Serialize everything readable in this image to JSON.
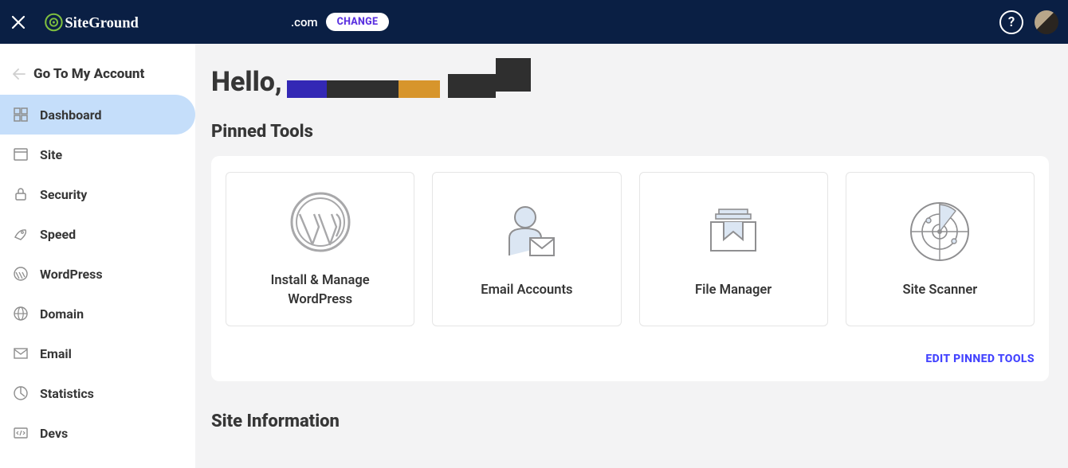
{
  "header": {
    "brand": "SiteGround",
    "domain_suffix": ".com",
    "change_label": "CHANGE",
    "help_glyph": "?"
  },
  "sidebar": {
    "back_label": "Go To My Account",
    "items": [
      {
        "label": "Dashboard",
        "icon": "dashboard-icon",
        "active": true
      },
      {
        "label": "Site",
        "icon": "site-icon",
        "active": false
      },
      {
        "label": "Security",
        "icon": "security-icon",
        "active": false
      },
      {
        "label": "Speed",
        "icon": "speed-icon",
        "active": false
      },
      {
        "label": "WordPress",
        "icon": "wordpress-icon",
        "active": false
      },
      {
        "label": "Domain",
        "icon": "domain-icon",
        "active": false
      },
      {
        "label": "Email",
        "icon": "email-icon",
        "active": false
      },
      {
        "label": "Statistics",
        "icon": "statistics-icon",
        "active": false
      },
      {
        "label": "Devs",
        "icon": "devs-icon",
        "active": false
      }
    ]
  },
  "main": {
    "greeting_prefix": "Hello,",
    "pinned_title": "Pinned Tools",
    "tools": [
      {
        "label": "Install & Manage WordPress"
      },
      {
        "label": "Email Accounts"
      },
      {
        "label": "File Manager"
      },
      {
        "label": "Site Scanner"
      }
    ],
    "edit_pinned_label": "EDIT PINNED TOOLS",
    "site_info_title": "Site Information"
  }
}
